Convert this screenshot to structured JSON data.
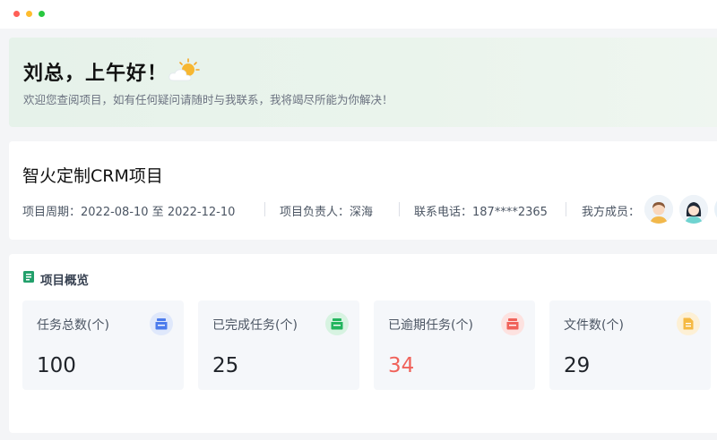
{
  "greeting": {
    "title": "刘总，上午好！",
    "subtitle": "欢迎您查阅项目，如有任何疑问请随时与我联系，我将竭尽所能为你解决！"
  },
  "project": {
    "name": "智火定制CRM项目",
    "period": "项目周期：2022-08-10 至 2022-12-10",
    "owner": "项目负责人：深海",
    "phone": "联系电话：187****2365",
    "members_label": "我方成员："
  },
  "overview": {
    "title": "项目概览",
    "cards": [
      {
        "label": "任务总数(个)",
        "value": "100",
        "icon": "inbox-icon",
        "color": "#4b7bec"
      },
      {
        "label": "已完成任务(个)",
        "value": "25",
        "icon": "inbox-icon",
        "color": "#22b55e"
      },
      {
        "label": "已逾期任务(个)",
        "value": "34",
        "icon": "inbox-icon",
        "color": "#f0625a"
      },
      {
        "label": "文件数(个)",
        "value": "29",
        "icon": "document-icon",
        "color": "#f5b942"
      }
    ]
  },
  "colors": {
    "accent": "#22a06b",
    "overdue": "#f0625a"
  }
}
